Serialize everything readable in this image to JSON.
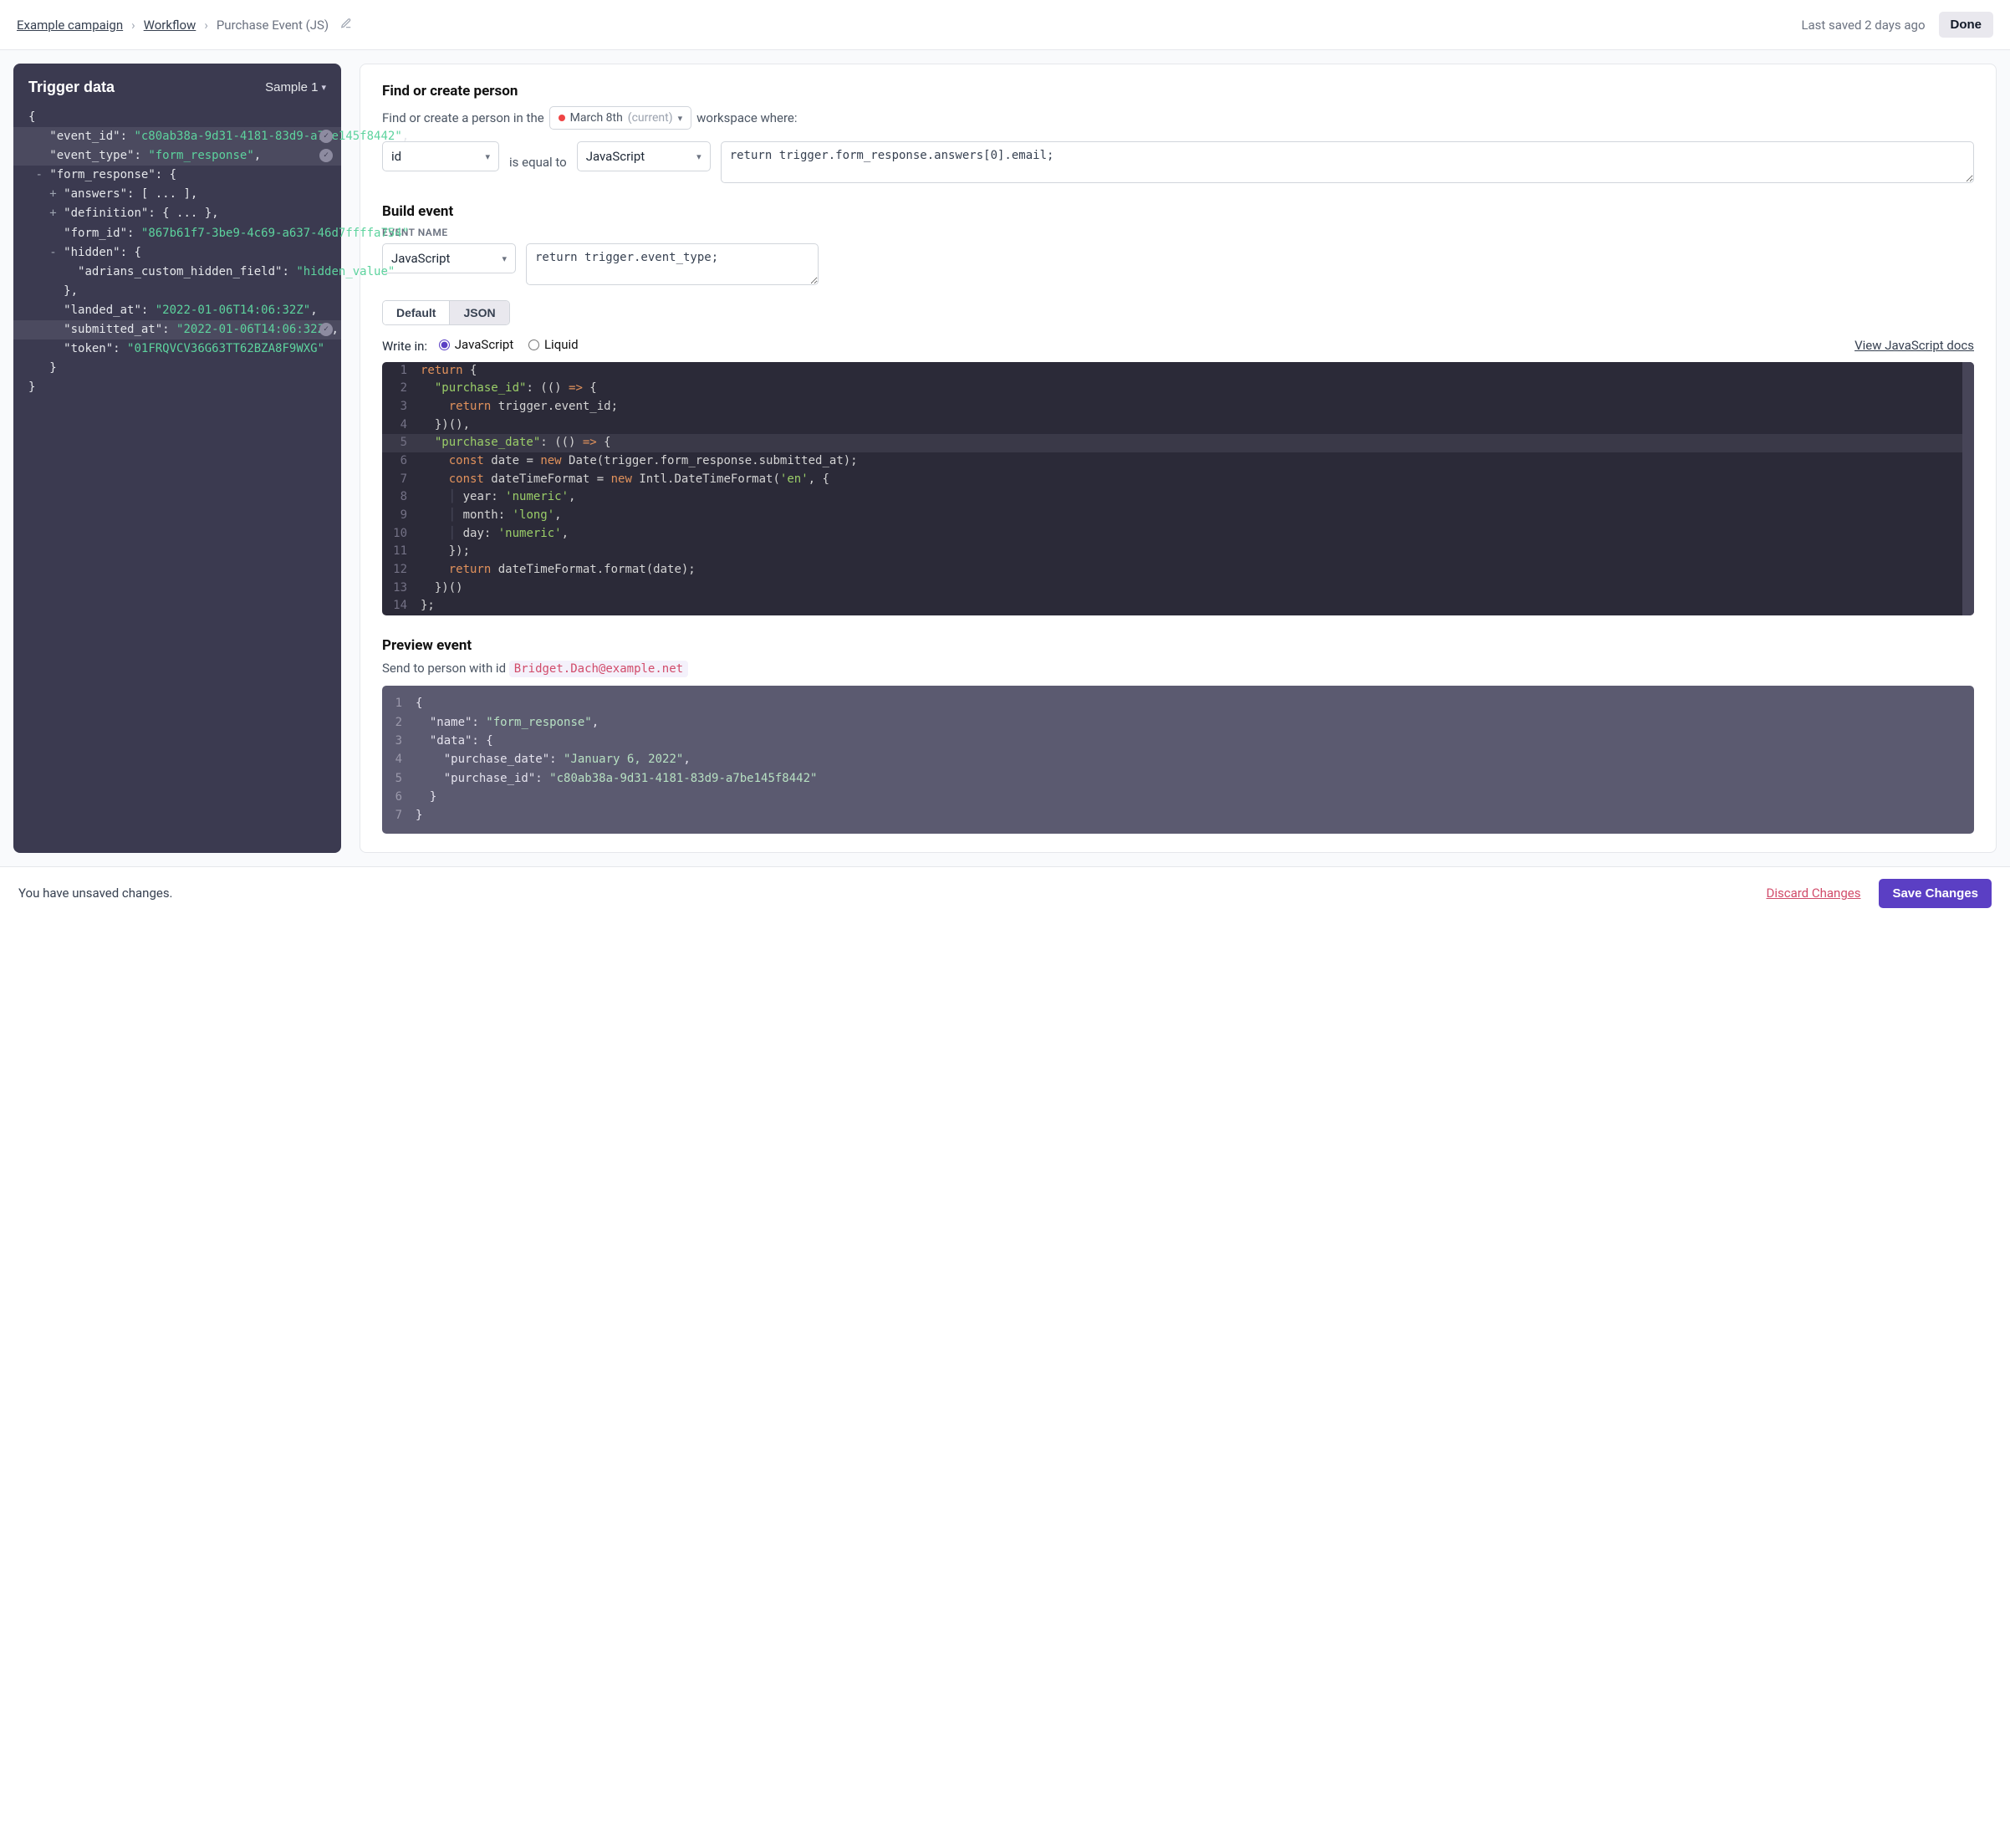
{
  "breadcrumb": {
    "campaign": "Example campaign",
    "workflow": "Workflow",
    "current": "Purchase Event (JS)"
  },
  "header": {
    "last_saved": "Last saved 2 days ago",
    "done": "Done"
  },
  "trigger": {
    "title": "Trigger data",
    "sample_label": "Sample 1",
    "json": {
      "open": "{",
      "event_id_key": "\"event_id\":",
      "event_id_val": "\"c80ab38a-9d31-4181-83d9-a7be145f8442\"",
      "event_type_key": "\"event_type\":",
      "event_type_val": "\"form_response\"",
      "form_response_key": "\"form_response\": {",
      "answers": "\"answers\": [ ... ],",
      "definition": "\"definition\": { ... },",
      "form_id_key": "\"form_id\":",
      "form_id_val": "\"867b61f7-3be9-4c69-a637-46d7ffffa754\"",
      "hidden_key": "\"hidden\": {",
      "hidden_field_key": "\"adrians_custom_hidden_field\":",
      "hidden_field_val": "\"hidden_value\"",
      "hidden_close": "},",
      "landed_key": "\"landed_at\":",
      "landed_val": "\"2022-01-06T14:06:32Z\"",
      "submitted_key": "\"submitted_at\":",
      "submitted_val": "\"2022-01-06T14:06:32Z\"",
      "token_key": "\"token\":",
      "token_val": "\"01FRQVCV36G63TT62BZA8F9WXG\"",
      "form_close": "}",
      "root_close": "}"
    }
  },
  "find": {
    "title": "Find or create person",
    "helper_prefix": "Find or create a person in the",
    "workspace_name": "March 8th",
    "workspace_suffix": "(current)",
    "helper_suffix": "workspace where:",
    "attr": "id",
    "op": "is equal to",
    "mode": "JavaScript",
    "expr": "return trigger.form_response.answers[0].email;"
  },
  "build": {
    "title": "Build event",
    "event_name_label": "EVENT NAME",
    "event_name_mode": "JavaScript",
    "event_name_expr": "return trigger.event_type;",
    "tab_default": "Default",
    "tab_json": "JSON",
    "write_in_label": "Write in:",
    "lang_js": "JavaScript",
    "lang_liquid": "Liquid",
    "docs_link": "View JavaScript docs"
  },
  "editor": {
    "lines": [
      "return {",
      "  \"purchase_id\": (() => {",
      "    return trigger.event_id;",
      "  })(),",
      "  \"purchase_date\": (() => {",
      "    const date = new Date(trigger.form_response.submitted_at);",
      "    const dateTimeFormat = new Intl.DateTimeFormat('en', {",
      "      year: 'numeric',",
      "      month: 'long',",
      "      day: 'numeric',",
      "    });",
      "    return dateTimeFormat.format(date);",
      "  })()",
      "};"
    ]
  },
  "preview": {
    "title": "Preview event",
    "desc_prefix": "Send to person with id",
    "person_id": "Bridget.Dach@example.net",
    "lines": [
      "{",
      "  \"name\": \"form_response\",",
      "  \"data\": {",
      "    \"purchase_date\": \"January 6, 2022\",",
      "    \"purchase_id\": \"c80ab38a-9d31-4181-83d9-a7be145f8442\"",
      "  }",
      "}"
    ]
  },
  "footer": {
    "unsaved": "You have unsaved changes.",
    "discard": "Discard Changes",
    "save": "Save Changes"
  }
}
